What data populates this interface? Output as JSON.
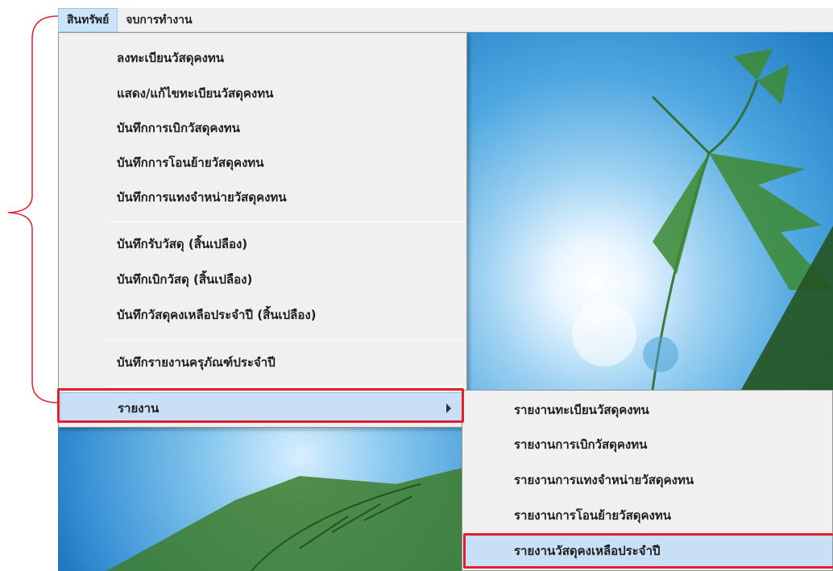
{
  "menubar": {
    "items": [
      {
        "label": "สินทรัพย์",
        "active": true
      },
      {
        "label": "จบการทำงาน",
        "active": false
      }
    ]
  },
  "menu": {
    "items": [
      {
        "label": "ลงทะเบียนวัสดุคงทน"
      },
      {
        "label": "แสดง/แก้ไขทะเบียนวัสดุคงทน"
      },
      {
        "label": "บันทึกการเบิกวัสดุคงทน"
      },
      {
        "label": "บันทึกการโอนย้ายวัสดุคงทน"
      },
      {
        "label": "บันทึกการแทงจำหน่ายวัสดุคงทน"
      },
      {
        "label": "บันทึกรับวัสดุ  (สิ้นเปลือง)"
      },
      {
        "label": "บันทึกเบิกวัสดุ  (สิ้นเปลือง)"
      },
      {
        "label": "บันทึกวัสดุคงเหลือประจำปี  (สิ้นเปลือง)"
      },
      {
        "label": "บันทึกรายงานครุภัณฑ์ประจำปี"
      },
      {
        "label": "รายงาน"
      }
    ]
  },
  "submenu": {
    "items": [
      {
        "label": "รายงานทะเบียนวัสดุคงทน"
      },
      {
        "label": "รายงานการเบิกวัสดุคงทน"
      },
      {
        "label": "รายงานการแทงจำหน่ายวัสดุคงทน"
      },
      {
        "label": "รายงานการโอนย้ายวัสดุคงทน"
      },
      {
        "label": "รายงานวัสดุคงเหลือประจำปี"
      }
    ]
  },
  "colors": {
    "highlight": "#c9dff5",
    "callout": "#e0202a",
    "menu_bg": "#f0f0f0"
  }
}
